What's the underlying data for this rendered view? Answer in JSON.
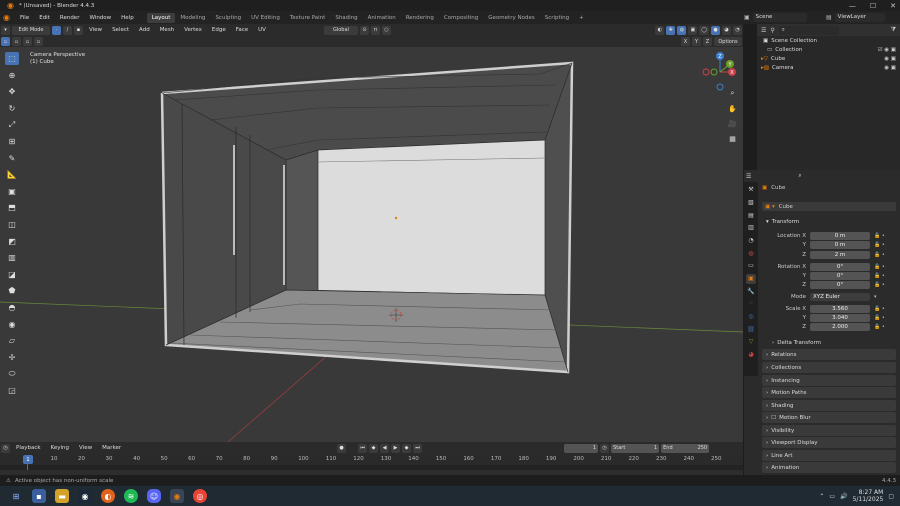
{
  "window": {
    "title": "* (Unsaved) - Blender 4.4.3",
    "min": "—",
    "max": "☐",
    "close": "✕"
  },
  "menu": [
    "File",
    "Edit",
    "Render",
    "Window",
    "Help"
  ],
  "workspaces": [
    "Layout",
    "Modeling",
    "Sculpting",
    "UV Editing",
    "Texture Paint",
    "Shading",
    "Animation",
    "Rendering",
    "Compositing",
    "Geometry Nodes",
    "Scripting",
    "+"
  ],
  "active_workspace": "Layout",
  "scene": {
    "label": "Scene",
    "view_layer": "ViewLayer"
  },
  "viewport_header": {
    "mode": "Edit Mode",
    "menus": [
      "View",
      "Select",
      "Add",
      "Mesh",
      "Vertex",
      "Edge",
      "Face",
      "UV"
    ],
    "transform_orientation": "Global",
    "axes": [
      "X",
      "Y",
      "Z"
    ],
    "options": "Options"
  },
  "viewport_info": {
    "line1": "Camera Perspective",
    "line2": "(1) Cube"
  },
  "gizmo": {
    "z": "Z",
    "y": "Y",
    "x": "X"
  },
  "outliner": {
    "search_placeholder": "",
    "items": [
      {
        "label": "Scene Collection",
        "indent": 0
      },
      {
        "label": "Collection",
        "indent": 1
      },
      {
        "label": "Cube",
        "indent": 2
      },
      {
        "label": "Camera",
        "indent": 2
      }
    ]
  },
  "properties": {
    "object_name": "Cube",
    "data_name": "Cube",
    "transform_header": "Transform",
    "location": {
      "label": "Location X",
      "x": "0 m",
      "y": "0 m",
      "z": "2 m"
    },
    "rotation": {
      "label": "Rotation X",
      "x": "0°",
      "y": "0°",
      "z": "0°"
    },
    "mode": {
      "label": "Mode",
      "value": "XYZ Euler"
    },
    "scale": {
      "label": "Scale X",
      "x": "3.560",
      "y": "3.040",
      "z": "2.000"
    },
    "axis_y": "Y",
    "axis_z": "Z",
    "delta": "Delta Transform",
    "panels": [
      "Relations",
      "Collections",
      "Instancing",
      "Motion Paths",
      "Shading",
      "Motion Blur",
      "Visibility",
      "Viewport Display",
      "Line Art",
      "Animation"
    ]
  },
  "timeline": {
    "menus": [
      "Playback",
      "Keying",
      "View",
      "Marker"
    ],
    "current_frame": "1",
    "start_label": "Start",
    "start": "1",
    "end_label": "End",
    "end": "250",
    "ticks": [
      "0",
      "10",
      "20",
      "30",
      "40",
      "50",
      "60",
      "70",
      "80",
      "90",
      "100",
      "110",
      "120",
      "130",
      "140",
      "150",
      "160",
      "170",
      "180",
      "190",
      "200",
      "210",
      "220",
      "230",
      "240",
      "250"
    ],
    "playhead_frame": "1"
  },
  "status": {
    "message": "Active object has non-uniform scale",
    "version": "4.4.3"
  },
  "taskbar": {
    "time": "8:27 AM",
    "date": "5/11/2025"
  },
  "colors": {
    "accent": "#4772b3",
    "orange": "#e87d0d",
    "x_axis": "#c8414b",
    "y_axis": "#6c9e2a",
    "z_axis": "#3b80d0"
  }
}
